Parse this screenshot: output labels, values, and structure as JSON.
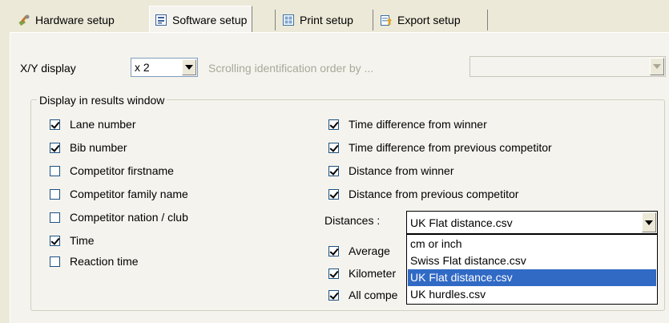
{
  "tabs": [
    {
      "label": "Hardware setup",
      "icon": "hardware-icon"
    },
    {
      "label": "Software setup",
      "icon": "software-icon",
      "active": true
    },
    {
      "label": "Print setup",
      "icon": "print-icon"
    },
    {
      "label": "Export setup",
      "icon": "export-icon"
    }
  ],
  "xy_display": {
    "label": "X/Y display",
    "value": "x 2"
  },
  "scrolling": {
    "label": "Scrolling identification order by ...",
    "value": ""
  },
  "group": {
    "title": "Display in results window"
  },
  "left_options": [
    {
      "label": "Lane number",
      "checked": true
    },
    {
      "label": "Bib number",
      "checked": true
    },
    {
      "label": "Competitor firstname",
      "checked": false
    },
    {
      "label": "Competitor family name",
      "checked": false
    },
    {
      "label": "Competitor nation / club",
      "checked": false
    },
    {
      "label": "Time",
      "checked": true
    },
    {
      "label": "Reaction time",
      "checked": false
    }
  ],
  "right_options": [
    {
      "label": "Time difference from winner",
      "checked": true
    },
    {
      "label": "Time difference from previous competitor",
      "checked": true
    },
    {
      "label": "Distance from winner",
      "checked": true
    },
    {
      "label": "Distance from previous competitor",
      "checked": true
    }
  ],
  "distances": {
    "label": "Distances :",
    "value": "UK Flat distance.csv"
  },
  "partial_options": [
    {
      "label": "Average",
      "checked": true
    },
    {
      "label": "Kilometer",
      "checked": true
    },
    {
      "label": "All compe",
      "checked": true
    }
  ],
  "distance_options": [
    {
      "label": "cm or inch",
      "selected": false
    },
    {
      "label": "Swiss Flat distance.csv",
      "selected": false
    },
    {
      "label": "UK Flat distance.csv",
      "selected": true
    },
    {
      "label": "UK hurdles.csv",
      "selected": false
    }
  ],
  "colors": {
    "selection": "#316ac5",
    "face": "#ece9d8",
    "panel": "#f4f3ee"
  }
}
